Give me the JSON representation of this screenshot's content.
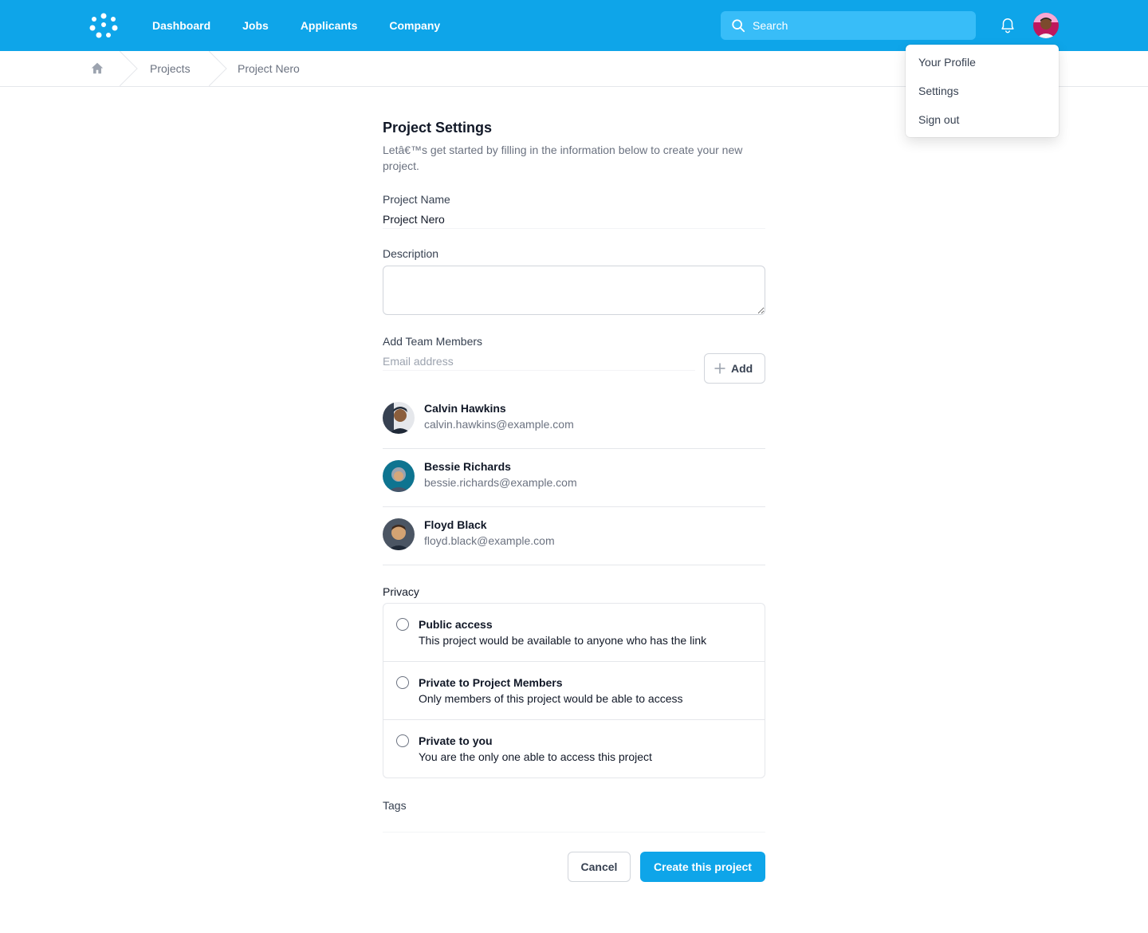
{
  "nav": {
    "links": [
      "Dashboard",
      "Jobs",
      "Applicants",
      "Company"
    ],
    "search_placeholder": "Search",
    "accent": "#0ea5e9"
  },
  "breadcrumb": {
    "items": [
      "Projects",
      "Project Nero"
    ]
  },
  "user_menu": {
    "items": [
      "Your Profile",
      "Settings",
      "Sign out"
    ]
  },
  "form": {
    "title": "Project Settings",
    "subtitle": "Letâ€™s get started by filling in the information below to create your new project.",
    "project_name_label": "Project Name",
    "project_name_value": "Project Nero",
    "description_label": "Description",
    "team_label": "Add Team Members",
    "email_placeholder": "Email address",
    "add_label": "Add",
    "members": [
      {
        "name": "Calvin Hawkins",
        "email": "calvin.hawkins@example.com"
      },
      {
        "name": "Bessie Richards",
        "email": "bessie.richards@example.com"
      },
      {
        "name": "Floyd Black",
        "email": "floyd.black@example.com"
      }
    ],
    "privacy_label": "Privacy",
    "privacy_options": [
      {
        "title": "Public access",
        "desc": "This project would be available to anyone who has the link"
      },
      {
        "title": "Private to Project Members",
        "desc": "Only members of this project would be able to access"
      },
      {
        "title": "Private to you",
        "desc": "You are the only one able to access this project"
      }
    ],
    "tags_label": "Tags",
    "cancel_label": "Cancel",
    "submit_label": "Create this project"
  }
}
